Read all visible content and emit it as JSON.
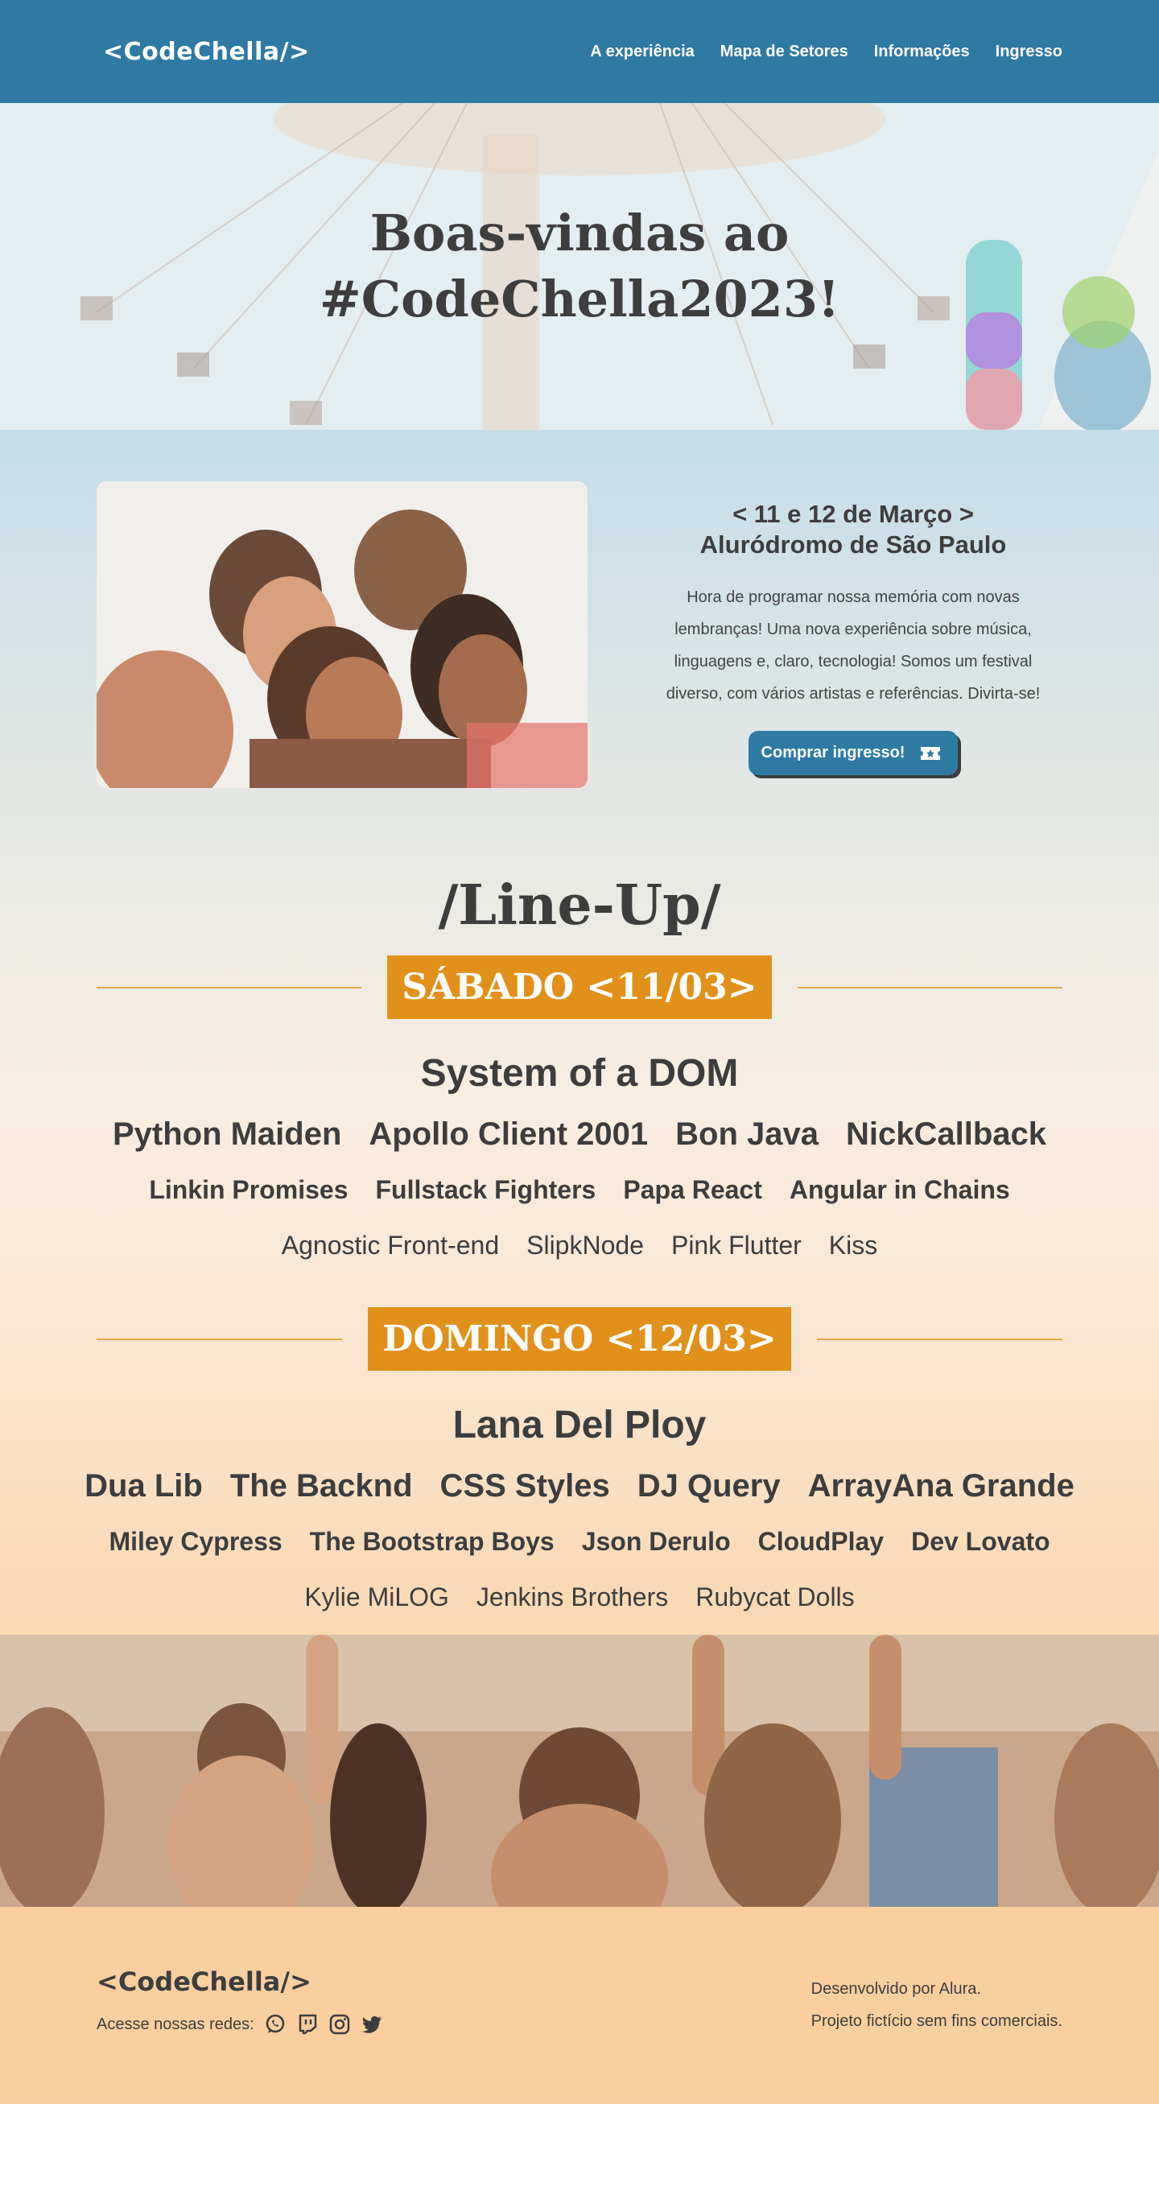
{
  "header": {
    "logo": "<CodeChella/>",
    "nav": [
      "A experiência",
      "Mapa de Setores",
      "Informações",
      "Ingresso"
    ]
  },
  "hero": {
    "title_line1": "Boas-vindas ao",
    "title_line2": "#CodeChella2023!"
  },
  "intro": {
    "date": "< 11 e 12 de Março >",
    "place": "Aluródromo de São Paulo",
    "description": "Hora de programar nossa memória com novas lembranças! Uma nova experiência sobre música, linguagens e, claro, tecnologia! Somos um festival diverso, com vários artistas e referências. Divirta-se!",
    "button": "Comprar ingresso!"
  },
  "lineup": {
    "title": "/Line-Up/",
    "days": [
      {
        "label": "SÁBADO <11/03>",
        "headliner": "System of a DOM",
        "row1": [
          "Python Maiden",
          "Apollo Client 2001",
          "Bon Java",
          "NickCallback"
        ],
        "row2": [
          "Linkin Promises",
          "Fullstack Fighters",
          "Papa React",
          "Angular in Chains"
        ],
        "row3": [
          "Agnostic Front-end",
          "SlipkNode",
          "Pink Flutter",
          "Kiss"
        ]
      },
      {
        "label": "DOMINGO <12/03>",
        "headliner": "Lana Del Ploy",
        "row1": [
          "Dua Lib",
          "The Backnd",
          "CSS Styles",
          "DJ Query",
          "ArrayAna Grande"
        ],
        "row2": [
          "Miley Cypress",
          "The Bootstrap Boys",
          "Json Derulo",
          "CloudPlay",
          "Dev Lovato"
        ],
        "row3": [
          "Kylie MiLOG",
          "Jenkins Brothers",
          "Rubycat Dolls"
        ]
      }
    ]
  },
  "footer": {
    "logo": "<CodeChella/>",
    "social_label": "Acesse nossas redes:",
    "social_icons": [
      "whatsapp-icon",
      "twitch-icon",
      "instagram-icon",
      "twitter-icon"
    ],
    "credit1": "Desenvolvido por Alura.",
    "credit2": "Projeto fictício sem fins comerciais."
  },
  "colors": {
    "header": "#2f7aa3",
    "accent": "#e1911a",
    "footer": "#f9cfa0",
    "text": "#3d3d3d"
  }
}
